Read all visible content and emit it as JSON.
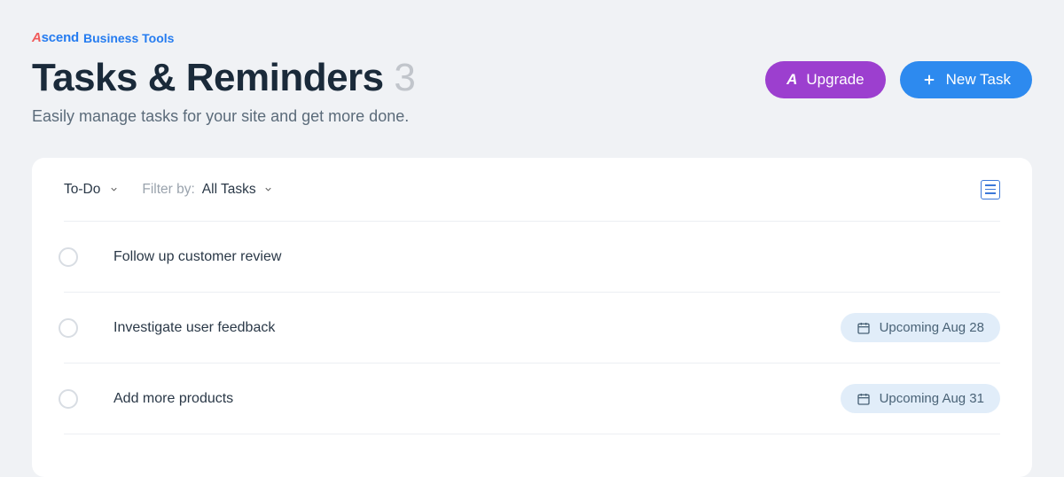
{
  "brand": {
    "name_first_letter": "A",
    "name_rest": "scend",
    "sub": "Business Tools"
  },
  "header": {
    "title": "Tasks & Reminders",
    "count": "3",
    "subtitle": "Easily manage tasks for your site and get more done.",
    "upgrade_label": "Upgrade",
    "new_task_label": "New Task"
  },
  "filters": {
    "status": "To-Do",
    "filter_by_label": "Filter by:",
    "filter_by_value": "All Tasks"
  },
  "tasks": [
    {
      "title": "Follow up customer review",
      "badge": null
    },
    {
      "title": "Investigate user feedback",
      "badge": "Upcoming Aug 28"
    },
    {
      "title": "Add more products",
      "badge": "Upcoming Aug 31"
    }
  ]
}
